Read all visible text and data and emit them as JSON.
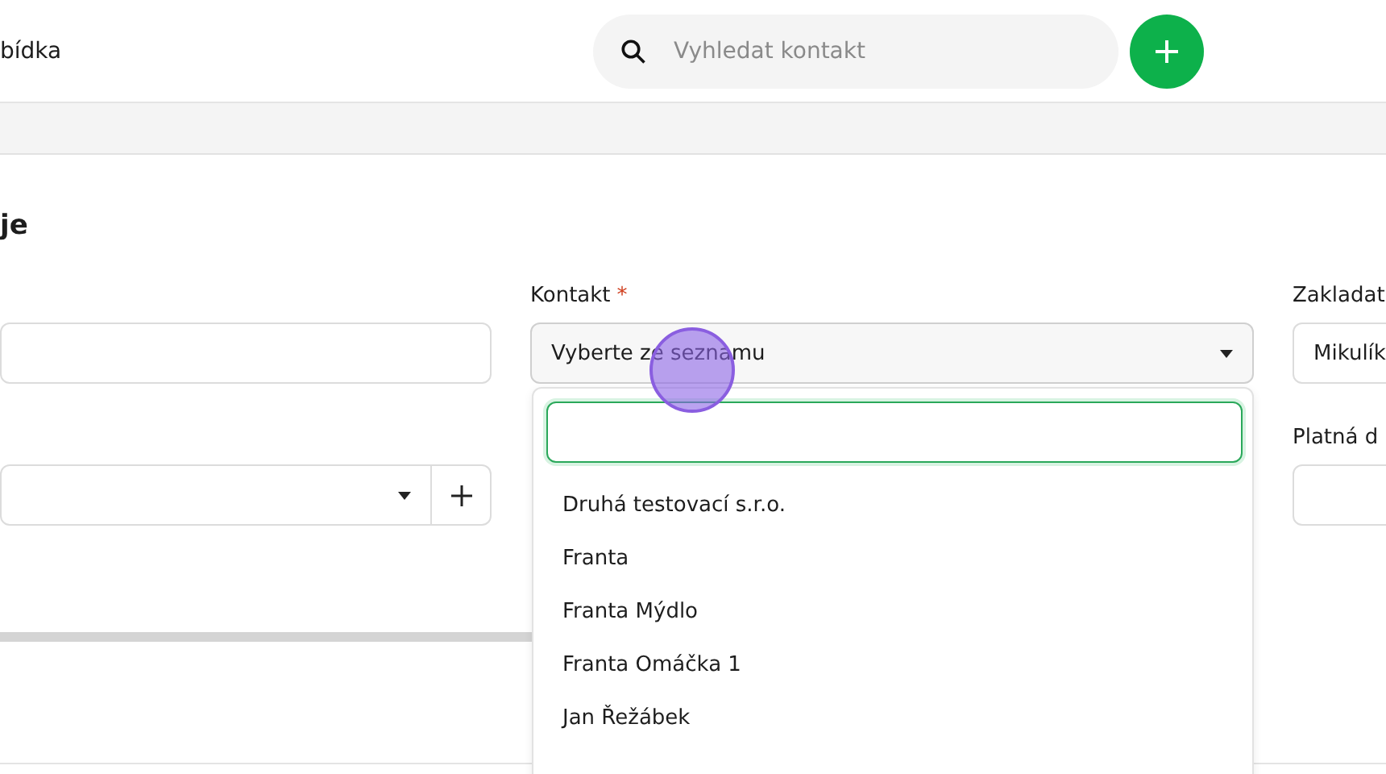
{
  "header": {
    "title": "bídka",
    "search": {
      "placeholder": "Vyhledat kontakt"
    }
  },
  "section": {
    "title": "je"
  },
  "fields": {
    "contact": {
      "label": "Kontakt",
      "required_mark": "*",
      "placeholder": "Vyberte ze seznamu",
      "expanded": true,
      "dropdown": {
        "options": [
          {
            "label": "Druhá testovací s.r.o."
          },
          {
            "label": "Franta"
          },
          {
            "label": "Franta Mýdlo"
          },
          {
            "label": "Franta Omáčka 1"
          },
          {
            "label": "Jan Řežábek"
          }
        ]
      }
    },
    "creator": {
      "label": "Zakladat",
      "value": "Mikulík"
    },
    "valid_until": {
      "label": "Platná d"
    }
  }
}
